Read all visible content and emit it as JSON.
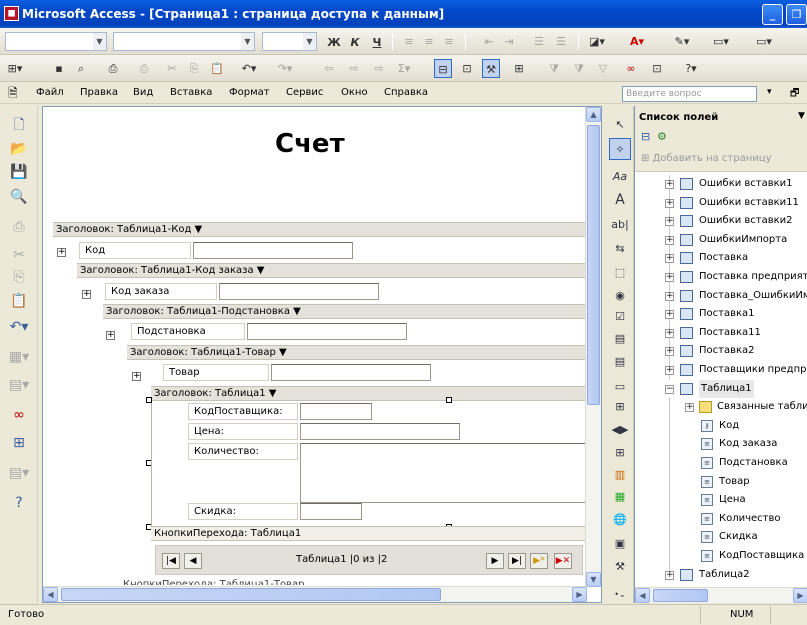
{
  "window": {
    "title": "Microsoft Access - [Страница1 : страница доступа к данным]",
    "icon": "access-app-icon"
  },
  "format_toolbar": {
    "bold": "Ж",
    "italic": "К",
    "underline": "Ч"
  },
  "menu": {
    "items": [
      "Файл",
      "Правка",
      "Вид",
      "Вставка",
      "Формат",
      "Сервис",
      "Окно",
      "Справка"
    ],
    "ask_placeholder": "Введите вопрос"
  },
  "page": {
    "title": "Счет",
    "groups": [
      {
        "header": "Заголовок: Таблица1-Код ▼",
        "label": "Код"
      },
      {
        "header": "Заголовок: Таблица1-Код заказа ▼",
        "label": "Код заказа"
      },
      {
        "header": "Заголовок: Таблица1-Подстановка ▼",
        "label": "Подстановка"
      },
      {
        "header": "Заголовок: Таблица1-Товар ▼",
        "label": "Товар"
      }
    ],
    "detail": {
      "header": "Заголовок: Таблица1 ▼",
      "fields": [
        "КодПоставщика:",
        "Цена:",
        "Количество:",
        "Скидка:"
      ]
    },
    "nav_header": "КнопкиПерехода: Таблица1",
    "nav_record_text": "Таблица1 |0 из |2",
    "nav_header2": "КнопкиПерехода: Таблица1-Товар"
  },
  "field_list": {
    "title": "Список полей",
    "add_to_page": "Добавить на страницу",
    "tables": [
      "Ошибки вставки1",
      "Ошибки вставки11",
      "Ошибки вставки2",
      "ОшибкиИмпорта",
      "Поставка",
      "Поставка предприятий",
      "Поставка_ОшибкиИмпорта",
      "Поставка1",
      "Поставка11",
      "Поставка2",
      "Поставщики предприятий"
    ],
    "expanded_table": "Таблица1",
    "related": "Связанные таблицы",
    "fields": [
      "Код",
      "Код заказа",
      "Подстановка",
      "Товар",
      "Цена",
      "Количество",
      "Скидка",
      "КодПоставщика"
    ],
    "next_table": "Таблица2"
  },
  "status": {
    "left": "Готово",
    "num": "NUM"
  }
}
